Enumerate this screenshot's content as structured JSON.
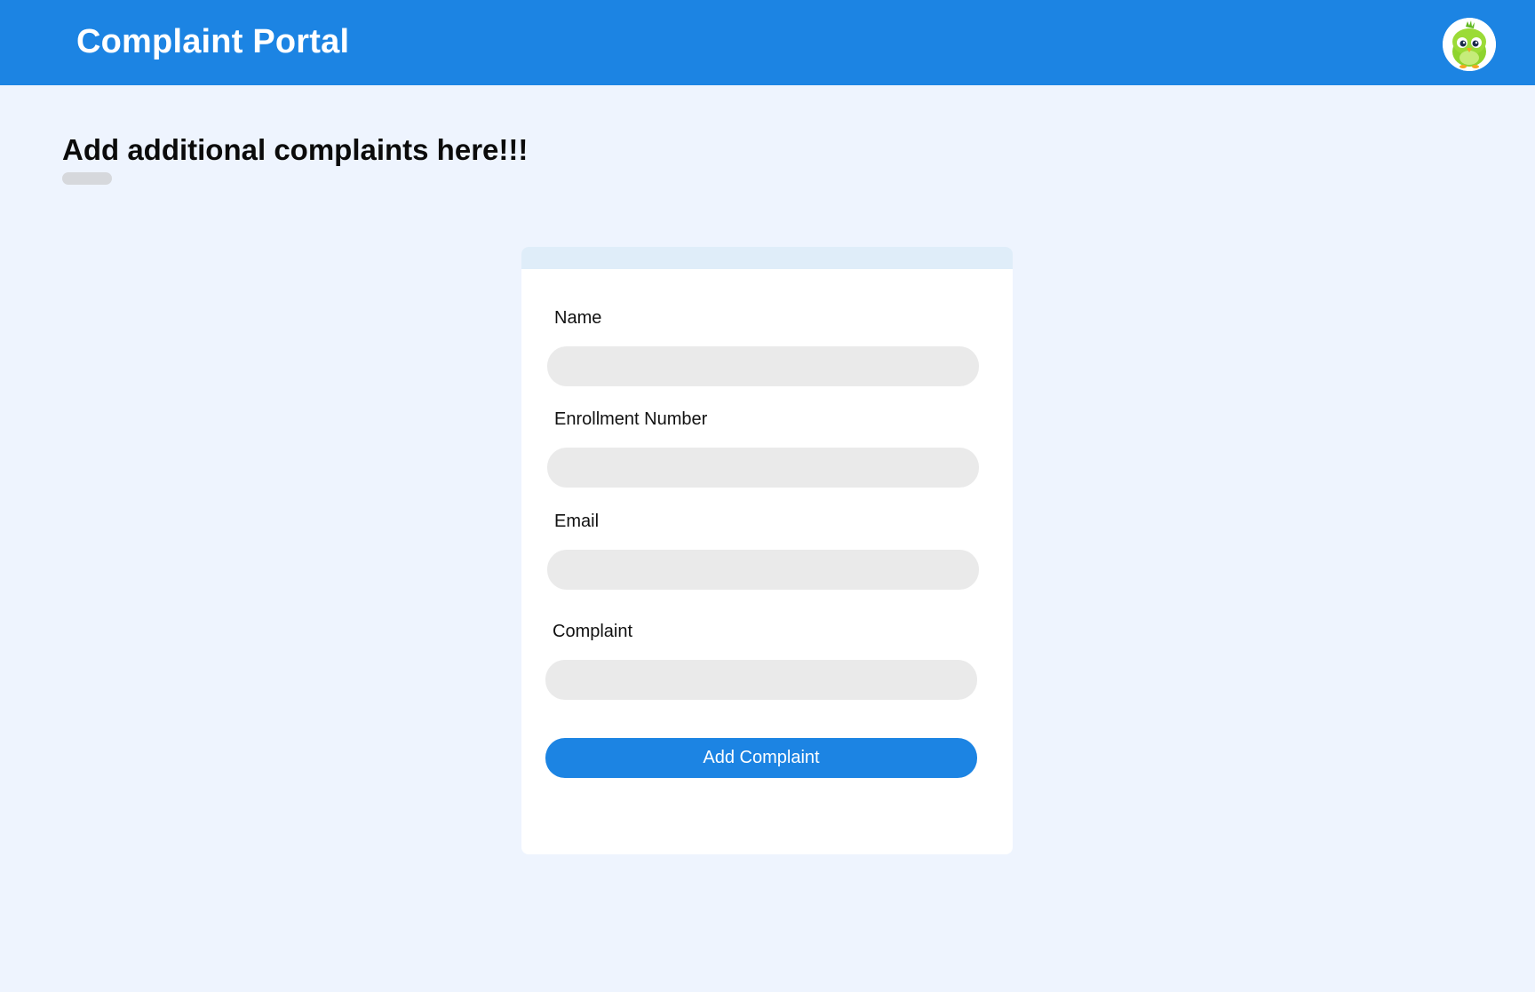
{
  "header": {
    "title": "Complaint Portal",
    "avatar_icon": "parrot-mascot-avatar-icon",
    "color": "#1C84E3"
  },
  "main": {
    "heading": "Add additional complaints here!!!"
  },
  "form": {
    "fields": [
      {
        "label": "Name",
        "value": "",
        "placeholder": ""
      },
      {
        "label": "Enrollment Number",
        "value": "",
        "placeholder": ""
      },
      {
        "label": "Email",
        "value": "",
        "placeholder": ""
      },
      {
        "label": "Complaint",
        "value": "",
        "placeholder": ""
      }
    ],
    "submit_label": "Add Complaint"
  },
  "colors": {
    "accent": "#1C84E3",
    "page_background": "#EEF4FE",
    "input_background": "#EAEAEA",
    "card_header": "#DFEDF9"
  }
}
